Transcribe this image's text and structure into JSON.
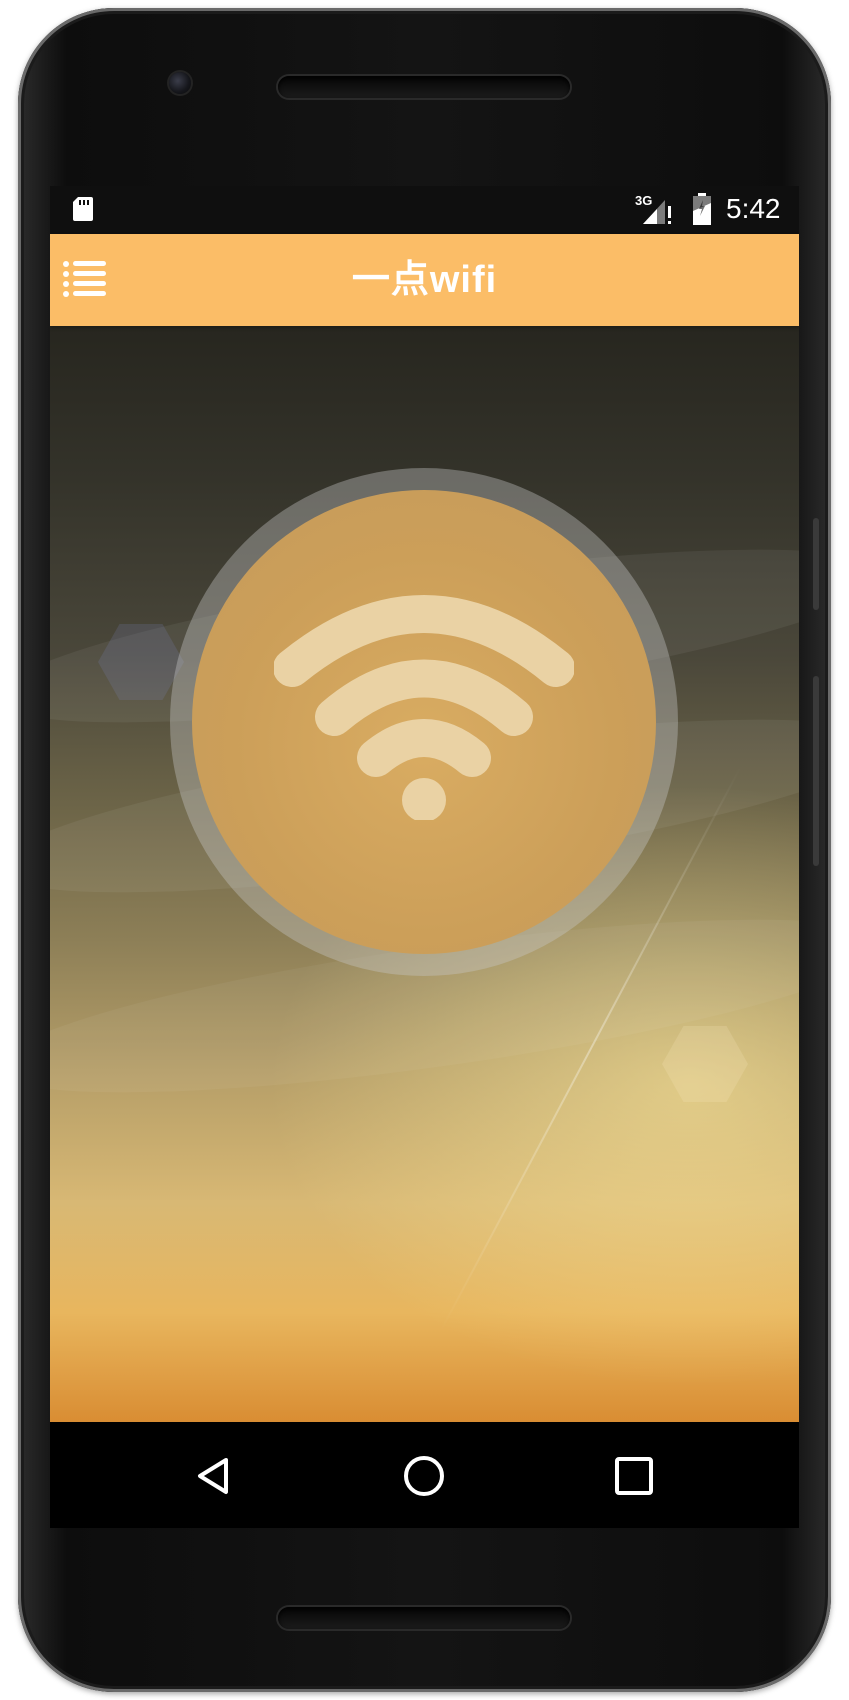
{
  "status_bar": {
    "network_type": "3G",
    "time": "5:42",
    "icons": [
      "sd-card-icon",
      "signal-icon",
      "battery-icon"
    ]
  },
  "app_bar": {
    "title": "一点wifi",
    "menu_icon": "menu-icon",
    "background_color": "#fbbd67"
  },
  "main": {
    "connect_button_icon": "wifi-icon",
    "accent_color": "#d4a55c"
  },
  "nav_bar": {
    "buttons": [
      "back-icon",
      "home-icon",
      "recent-apps-icon"
    ]
  }
}
